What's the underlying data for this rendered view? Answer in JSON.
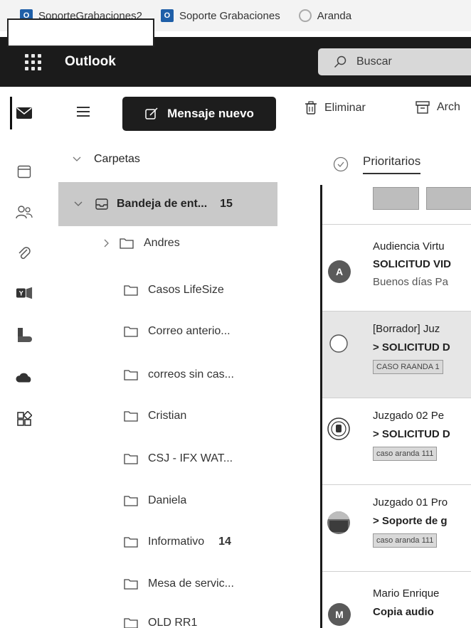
{
  "bookmarks": [
    {
      "label": "SoporteGrabaciones2",
      "icon": "outlook-icon"
    },
    {
      "label": "Soporte Grabaciones",
      "icon": "outlook-icon"
    },
    {
      "label": "Aranda",
      "icon": "aranda-icon"
    }
  ],
  "header": {
    "app_title": "Outlook",
    "search_placeholder": "Buscar"
  },
  "toolbar": {
    "new_message": "Mensaje nuevo",
    "delete": "Eliminar",
    "archive": "Arch"
  },
  "rail": {
    "icons": [
      "mail-icon",
      "calendar-icon",
      "people-icon",
      "attachment-icon",
      "yammer-icon",
      "bookings-icon",
      "onedrive-icon",
      "apps-icon"
    ]
  },
  "folders": {
    "section_label": "Carpetas",
    "inbox": {
      "label": "Bandeja de ent...",
      "count": "15"
    },
    "items": [
      {
        "label": "Andres",
        "count": ""
      },
      {
        "label": "Casos LifeSize",
        "count": ""
      },
      {
        "label": "Correo anterio...",
        "count": ""
      },
      {
        "label": "correos sin cas...",
        "count": ""
      },
      {
        "label": "Cristian",
        "count": ""
      },
      {
        "label": "CSJ - IFX WAT...",
        "count": ""
      },
      {
        "label": "Daniela",
        "count": ""
      },
      {
        "label": "Informativo",
        "count": "14"
      },
      {
        "label": "Mesa de servic...",
        "count": ""
      },
      {
        "label": "OLD RR1",
        "count": ""
      }
    ]
  },
  "mail_list": {
    "tab_label": "Prioritarios",
    "items": [
      {
        "avatar": "A",
        "sender": "Audiencia Virtu",
        "subject": "SOLICITUD VID",
        "preview": "Buenos días Pa",
        "tag": ""
      },
      {
        "avatar": "",
        "sender": "[Borrador] Juz",
        "subject": "> SOLICITUD D",
        "preview": "",
        "tag": "CASO RAANDA 1"
      },
      {
        "avatar": "",
        "sender": "Juzgado 02 Pe",
        "subject": "> SOLICITUD D",
        "preview": "",
        "tag": "caso aranda 111"
      },
      {
        "avatar": "",
        "sender": "Juzgado 01 Pro",
        "subject": "> Soporte de g",
        "preview": "",
        "tag": "caso aranda 111"
      },
      {
        "avatar": "M",
        "sender": "Mario Enrique",
        "subject": "Copia audio",
        "preview": "",
        "tag": ""
      }
    ]
  },
  "colors": {
    "header_bg": "#1b1b1b",
    "selected_folder_bg": "#c9c9c9",
    "avatar_gray": "#5a5a5a"
  }
}
